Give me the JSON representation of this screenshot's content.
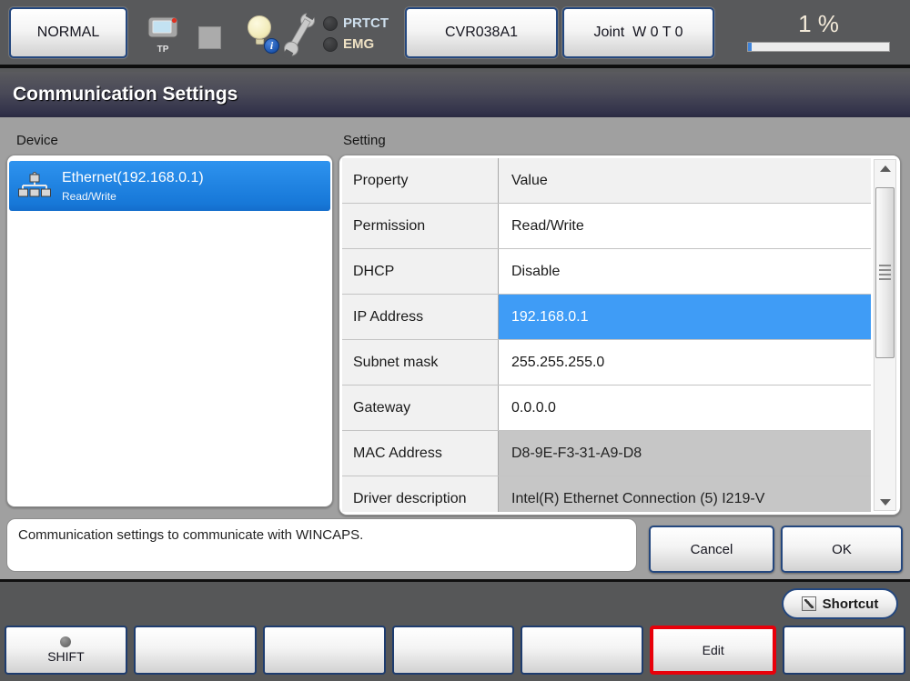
{
  "topbar": {
    "mode_button_label": "NORMAL",
    "tp_icon_label": "TP",
    "prtct_label": "PRTCT",
    "emg_label": "EMG",
    "program_button_label": "CVR038A1",
    "joint_button_label": "Joint  W 0 T 0",
    "speed_text": "1 %",
    "speed_percent": 1
  },
  "title_bar": {
    "title": "Communication Settings"
  },
  "content": {
    "device_section_label": "Device",
    "setting_section_label": "Setting",
    "device_list": [
      {
        "name": "Ethernet(192.168.0.1)",
        "permission": "Read/Write",
        "selected": true,
        "icon": "network-icon"
      }
    ],
    "settings_table": {
      "rows": [
        {
          "property": "Property",
          "value": "Value",
          "type": "header"
        },
        {
          "property": "Permission",
          "value": "Read/Write",
          "type": "normal"
        },
        {
          "property": "DHCP",
          "value": "Disable",
          "type": "normal"
        },
        {
          "property": "IP Address",
          "value": "192.168.0.1",
          "type": "selected"
        },
        {
          "property": "Subnet mask",
          "value": "255.255.255.0",
          "type": "normal"
        },
        {
          "property": "Gateway",
          "value": "0.0.0.0",
          "type": "normal"
        },
        {
          "property": "MAC Address",
          "value": "D8-9E-F3-31-A9-D8",
          "type": "readonly"
        },
        {
          "property": "Driver description",
          "value": "Intel(R) Ethernet Connection (5) I219-V",
          "type": "readonly"
        }
      ]
    },
    "message_text": "Communication settings to communicate with WINCAPS.",
    "cancel_button_label": "Cancel",
    "ok_button_label": "OK"
  },
  "bottom_bar": {
    "shortcut_button_label": "Shortcut",
    "function_keys": [
      {
        "label": "SHIFT",
        "has_indicator_dot": true,
        "highlighted": false
      },
      {
        "label": "",
        "has_indicator_dot": false,
        "highlighted": false
      },
      {
        "label": "",
        "has_indicator_dot": false,
        "highlighted": false
      },
      {
        "label": "",
        "has_indicator_dot": false,
        "highlighted": false
      },
      {
        "label": "",
        "has_indicator_dot": false,
        "highlighted": false
      },
      {
        "label": "Edit",
        "has_indicator_dot": false,
        "highlighted": true
      },
      {
        "label": "",
        "has_indicator_dot": false,
        "highlighted": false
      }
    ]
  },
  "colors": {
    "selection_blue": "#3f9cf6",
    "device_selected_blue": "#1f82e0",
    "edit_highlight_red": "#e8000a",
    "readonly_gray": "#c6c6c6",
    "topbar_gray": "#58595b",
    "title_gradient_bottom": "#2b2b42"
  }
}
